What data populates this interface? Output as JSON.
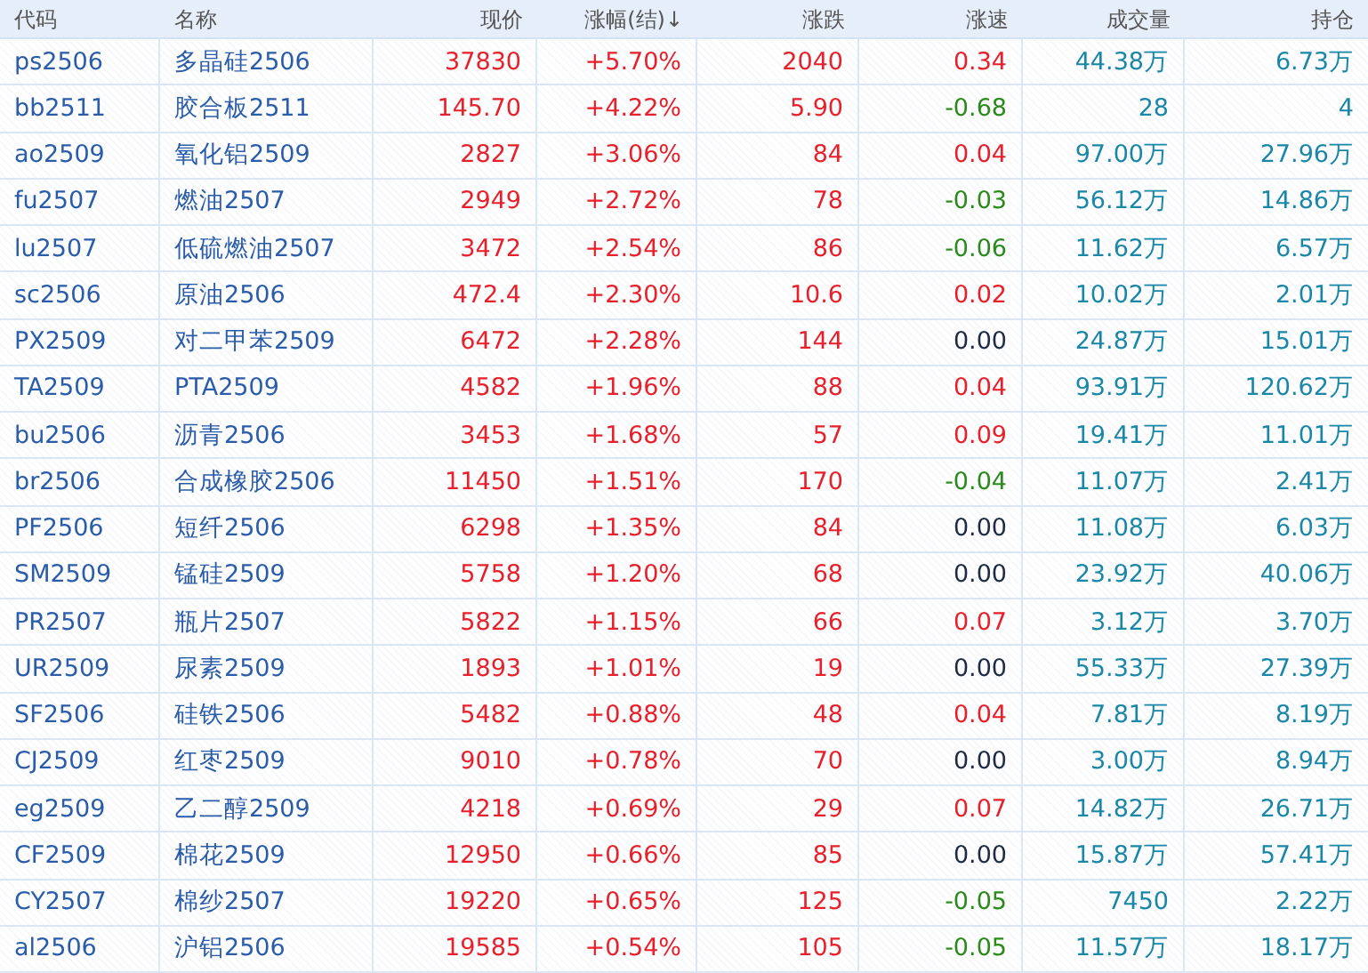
{
  "table": {
    "columns": [
      "代码",
      "名称",
      "现价",
      "涨幅(结)↓",
      "涨跌",
      "涨速",
      "成交量",
      "持仓"
    ],
    "rows": [
      {
        "code": "ps2506",
        "name": "多晶硅2506",
        "price": "37830",
        "pct": "+5.70%",
        "change": "2040",
        "color": "#e8202a",
        "speed": {
          "text": "0.34",
          "color": "#e8202a"
        },
        "volume": "44.38万",
        "open_interest": "6.73万"
      },
      {
        "code": "bb2511",
        "name": "胶合板2511",
        "price": "145.70",
        "pct": "+4.22%",
        "change": "5.90",
        "color": "#e8202a",
        "speed": {
          "text": "-0.68",
          "color": "#2a8a1a"
        },
        "volume": "28",
        "open_interest": "4"
      },
      {
        "code": "ao2509",
        "name": "氧化铝2509",
        "price": "2827",
        "pct": "+3.06%",
        "change": "84",
        "color": "#e8202a",
        "speed": {
          "text": "0.04",
          "color": "#e8202a"
        },
        "volume": "97.00万",
        "open_interest": "27.96万"
      },
      {
        "code": "fu2507",
        "name": "燃油2507",
        "price": "2949",
        "pct": "+2.72%",
        "change": "78",
        "color": "#e8202a",
        "speed": {
          "text": "-0.03",
          "color": "#2a8a1a"
        },
        "volume": "56.12万",
        "open_interest": "14.86万"
      },
      {
        "code": "lu2507",
        "name": "低硫燃油2507",
        "price": "3472",
        "pct": "+2.54%",
        "change": "86",
        "color": "#e8202a",
        "speed": {
          "text": "-0.06",
          "color": "#2a8a1a"
        },
        "volume": "11.62万",
        "open_interest": "6.57万"
      },
      {
        "code": "sc2506",
        "name": "原油2506",
        "price": "472.4",
        "pct": "+2.30%",
        "change": "10.6",
        "color": "#e8202a",
        "speed": {
          "text": "0.02",
          "color": "#e8202a"
        },
        "volume": "10.02万",
        "open_interest": "2.01万"
      },
      {
        "code": "PX2509",
        "name": "对二甲苯2509",
        "price": "6472",
        "pct": "+2.28%",
        "change": "144",
        "color": "#e8202a",
        "speed": {
          "text": "0.00",
          "color": "#1f2a44"
        },
        "volume": "24.87万",
        "open_interest": "15.01万"
      },
      {
        "code": "TA2509",
        "name": "PTA2509",
        "price": "4582",
        "pct": "+1.96%",
        "change": "88",
        "color": "#e8202a",
        "speed": {
          "text": "0.04",
          "color": "#e8202a"
        },
        "volume": "93.91万",
        "open_interest": "120.62万"
      },
      {
        "code": "bu2506",
        "name": "沥青2506",
        "price": "3453",
        "pct": "+1.68%",
        "change": "57",
        "color": "#e8202a",
        "speed": {
          "text": "0.09",
          "color": "#e8202a"
        },
        "volume": "19.41万",
        "open_interest": "11.01万"
      },
      {
        "code": "br2506",
        "name": "合成橡胶2506",
        "price": "11450",
        "pct": "+1.51%",
        "change": "170",
        "color": "#e8202a",
        "speed": {
          "text": "-0.04",
          "color": "#2a8a1a"
        },
        "volume": "11.07万",
        "open_interest": "2.41万"
      },
      {
        "code": "PF2506",
        "name": "短纤2506",
        "price": "6298",
        "pct": "+1.35%",
        "change": "84",
        "color": "#e8202a",
        "speed": {
          "text": "0.00",
          "color": "#1f2a44"
        },
        "volume": "11.08万",
        "open_interest": "6.03万"
      },
      {
        "code": "SM2509",
        "name": "锰硅2509",
        "price": "5758",
        "pct": "+1.20%",
        "change": "68",
        "color": "#e8202a",
        "speed": {
          "text": "0.00",
          "color": "#1f2a44"
        },
        "volume": "23.92万",
        "open_interest": "40.06万"
      },
      {
        "code": "PR2507",
        "name": "瓶片2507",
        "price": "5822",
        "pct": "+1.15%",
        "change": "66",
        "color": "#e8202a",
        "speed": {
          "text": "0.07",
          "color": "#e8202a"
        },
        "volume": "3.12万",
        "open_interest": "3.70万"
      },
      {
        "code": "UR2509",
        "name": "尿素2509",
        "price": "1893",
        "pct": "+1.01%",
        "change": "19",
        "color": "#e8202a",
        "speed": {
          "text": "0.00",
          "color": "#1f2a44"
        },
        "volume": "55.33万",
        "open_interest": "27.39万"
      },
      {
        "code": "SF2506",
        "name": "硅铁2506",
        "price": "5482",
        "pct": "+0.88%",
        "change": "48",
        "color": "#e8202a",
        "speed": {
          "text": "0.04",
          "color": "#e8202a"
        },
        "volume": "7.81万",
        "open_interest": "8.19万"
      },
      {
        "code": "CJ2509",
        "name": "红枣2509",
        "price": "9010",
        "pct": "+0.78%",
        "change": "70",
        "color": "#e8202a",
        "speed": {
          "text": "0.00",
          "color": "#1f2a44"
        },
        "volume": "3.00万",
        "open_interest": "8.94万"
      },
      {
        "code": "eg2509",
        "name": "乙二醇2509",
        "price": "4218",
        "pct": "+0.69%",
        "change": "29",
        "color": "#e8202a",
        "speed": {
          "text": "0.07",
          "color": "#e8202a"
        },
        "volume": "14.82万",
        "open_interest": "26.71万"
      },
      {
        "code": "CF2509",
        "name": "棉花2509",
        "price": "12950",
        "pct": "+0.66%",
        "change": "85",
        "color": "#e8202a",
        "speed": {
          "text": "0.00",
          "color": "#1f2a44"
        },
        "volume": "15.87万",
        "open_interest": "57.41万"
      },
      {
        "code": "CY2507",
        "name": "棉纱2507",
        "price": "19220",
        "pct": "+0.65%",
        "change": "125",
        "color": "#e8202a",
        "speed": {
          "text": "-0.05",
          "color": "#2a8a1a"
        },
        "volume": "7450",
        "open_interest": "2.22万"
      },
      {
        "code": "al2506",
        "name": "沪铝2506",
        "price": "19585",
        "pct": "+0.54%",
        "change": "105",
        "color": "#e8202a",
        "speed": {
          "text": "-0.05",
          "color": "#2a8a1a"
        },
        "volume": "11.57万",
        "open_interest": "18.17万"
      }
    ]
  }
}
